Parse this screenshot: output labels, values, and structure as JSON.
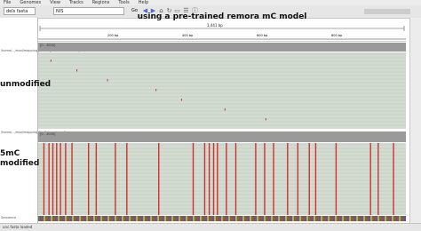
{
  "menu": [
    "File",
    "Genomes",
    "View",
    "Tracks",
    "Regions",
    "Tools",
    "Help"
  ],
  "toolbar": {
    "genome_value": "dels fasta",
    "locus_value": "NIS",
    "go_label": "Go"
  },
  "title": "using a pre-trained remora mC model",
  "ruler": {
    "span_label": "1,441 bp",
    "ticks": [
      "200 bp",
      "400 bp",
      "600 bp",
      "800 bp"
    ]
  },
  "tracks": [
    {
      "name": "/home/.../mod/mapping_unmod_bam.bam Coverage",
      "label": "unmodified",
      "cov_text": "[0 - 4000]"
    },
    {
      "name": "/home/.../mod/mapping_5mC_bam.bam Coverage",
      "label": "5mC modified",
      "cov_text": "[0 - 4000]"
    }
  ],
  "sequence_label": "Sequence",
  "status": {
    "left": "unc.fasta loaded",
    "right": "..."
  },
  "colors": {
    "methyl_mark": "#d0312d",
    "read_bg": "#d3dcd2",
    "coverage": "#9a9a9a"
  },
  "modification_marks": {
    "unmodified_positions_bp": [
      48,
      150,
      270,
      460,
      560,
      730,
      890
    ],
    "modified_positions_bp": [
      20,
      40,
      55,
      70,
      85,
      105,
      130,
      195,
      225,
      300,
      345,
      470,
      605,
      650,
      668,
      685,
      700,
      735,
      772,
      850,
      885,
      920,
      975,
      1015,
      1060,
      1085,
      1165,
      1300,
      1330,
      1390
    ]
  }
}
